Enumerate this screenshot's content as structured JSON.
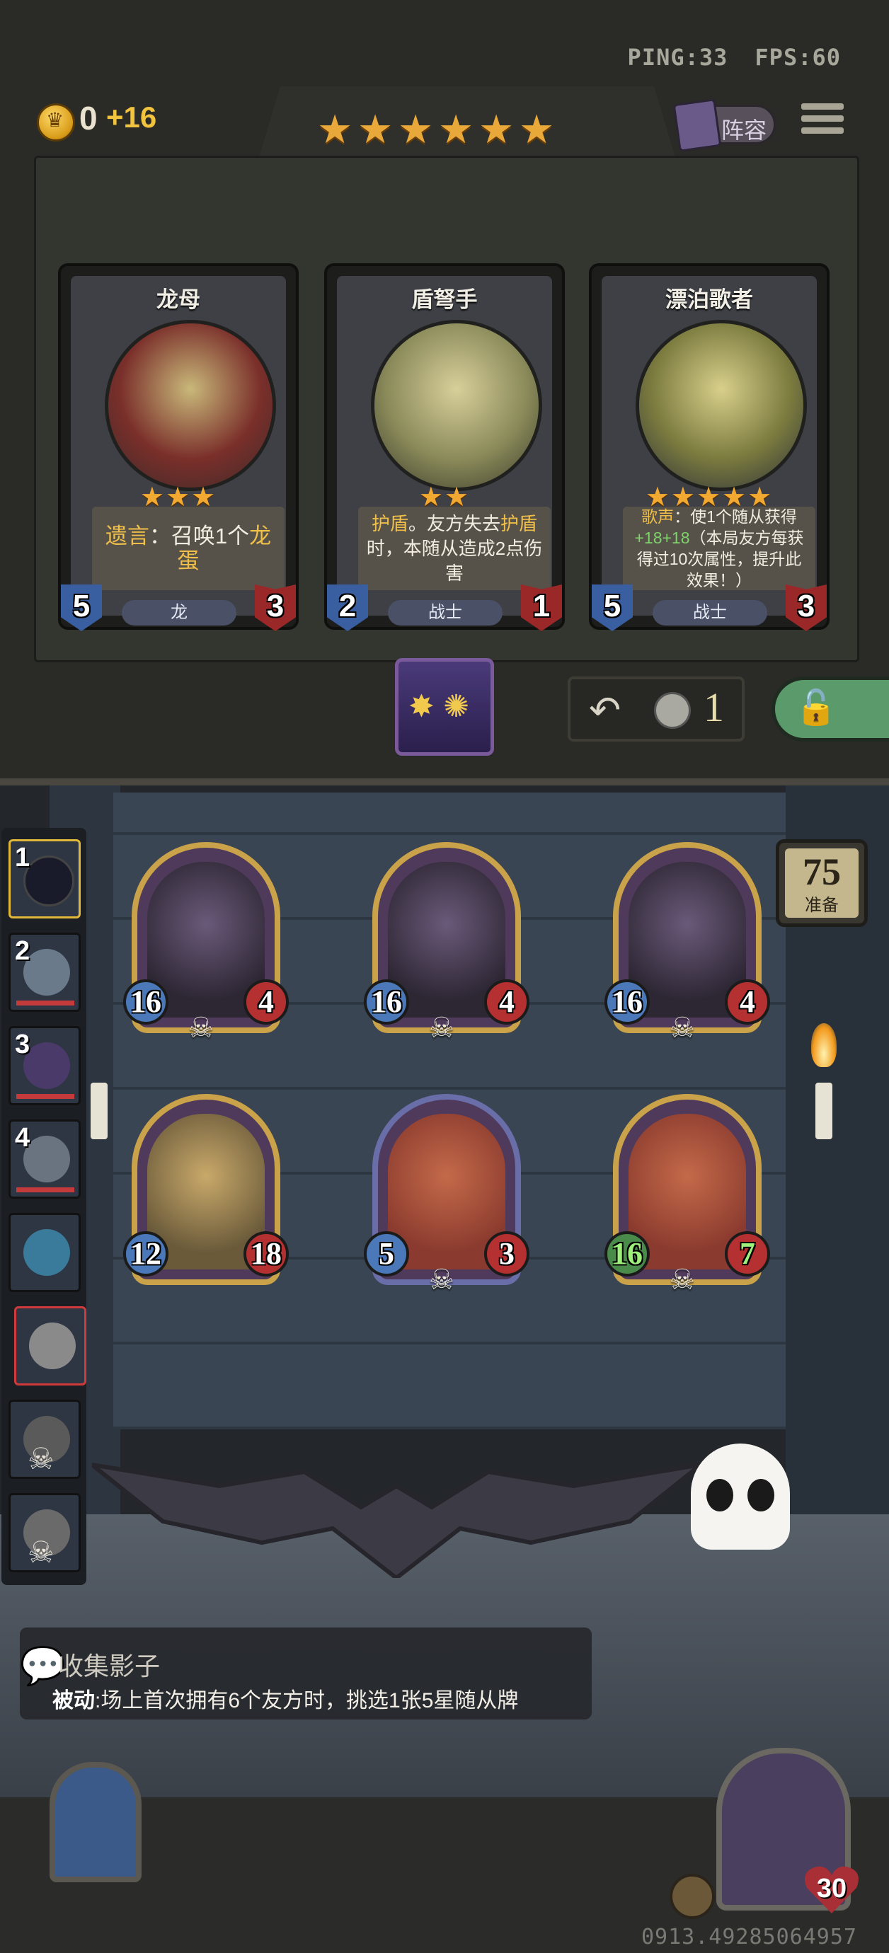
{
  "hud": {
    "ping": "PING:33",
    "fps": "FPS:60",
    "gold": "0",
    "gold_income": "+16",
    "tavern_tier_stars": 6,
    "lineup_label": "阵容"
  },
  "shop": {
    "cards": [
      {
        "name": "龙母",
        "stars": "★★★",
        "text_parts": [
          [
            "hl",
            "遗言"
          ],
          [
            "n",
            "：召唤1个"
          ],
          [
            "hl",
            "龙蛋"
          ]
        ],
        "tribe": "龙",
        "attack": "5",
        "health": "3",
        "art_color": "#7a2f2a"
      },
      {
        "name": "盾弩手",
        "stars": "★★",
        "text_parts": [
          [
            "hl",
            "护盾"
          ],
          [
            "n",
            "。友方失去"
          ],
          [
            "hl",
            "护盾"
          ],
          [
            "n",
            "时，本随从造成2点伤害"
          ]
        ],
        "tribe": "战士",
        "attack": "2",
        "health": "1",
        "art_color": "#8a8a5a"
      },
      {
        "name": "漂泊歌者",
        "stars": "★★★★★",
        "text_parts": [
          [
            "hl",
            "歌声"
          ],
          [
            "n",
            "：使1个随从获得"
          ],
          [
            "gr",
            "+18+18"
          ],
          [
            "n",
            "（本局友方每获得过10次属性，提升此效果！）"
          ]
        ],
        "tribe": "战士",
        "attack": "5",
        "health": "3",
        "art_color": "#7a7a3e"
      }
    ],
    "refresh_cost": "1"
  },
  "history": [
    {
      "num": "1",
      "color": "#1a1b2a",
      "state": "selected"
    },
    {
      "num": "2",
      "color": "#6a7a8a",
      "state": "normal"
    },
    {
      "num": "3",
      "color": "#4a3a6a",
      "state": "normal"
    },
    {
      "num": "4",
      "color": "#6a7480",
      "state": "normal"
    },
    {
      "num": "",
      "color": "#3a7a9a",
      "state": "normal"
    },
    {
      "num": "",
      "color": "#8a8a8a",
      "state": "highlight"
    },
    {
      "num": "",
      "color": "#5a5a5a",
      "state": "dead"
    },
    {
      "num": "",
      "color": "#6a6a6a",
      "state": "dead"
    }
  ],
  "ready": {
    "count": "75",
    "label": "准备"
  },
  "board": [
    {
      "attack": "16",
      "health": "4",
      "frame": "gold",
      "art": "#2d2633",
      "atk_buff": false,
      "hp_buff": false
    },
    {
      "attack": "16",
      "health": "4",
      "frame": "gold",
      "art": "#2d2633",
      "atk_buff": false,
      "hp_buff": false
    },
    {
      "attack": "16",
      "health": "4",
      "frame": "gold",
      "art": "#2d2633",
      "atk_buff": false,
      "hp_buff": false
    },
    {
      "attack": "12",
      "health": "18",
      "frame": "gold",
      "art": "#6a5a3a",
      "atk_buff": false,
      "hp_buff": false
    },
    {
      "attack": "5",
      "health": "3",
      "frame": "blue",
      "art": "#8a3a2e",
      "atk_buff": false,
      "hp_buff": false
    },
    {
      "attack": "16",
      "health": "7",
      "frame": "gold",
      "art": "#8a3a2e",
      "atk_buff": true,
      "hp_buff": true
    }
  ],
  "tooltip": {
    "title": "收集影子",
    "label": "被动",
    "desc": ":场上首次拥有6个友方时，挑选1张5星随从牌"
  },
  "hero": {
    "health": "30"
  },
  "watermark": "0913.49285064957"
}
